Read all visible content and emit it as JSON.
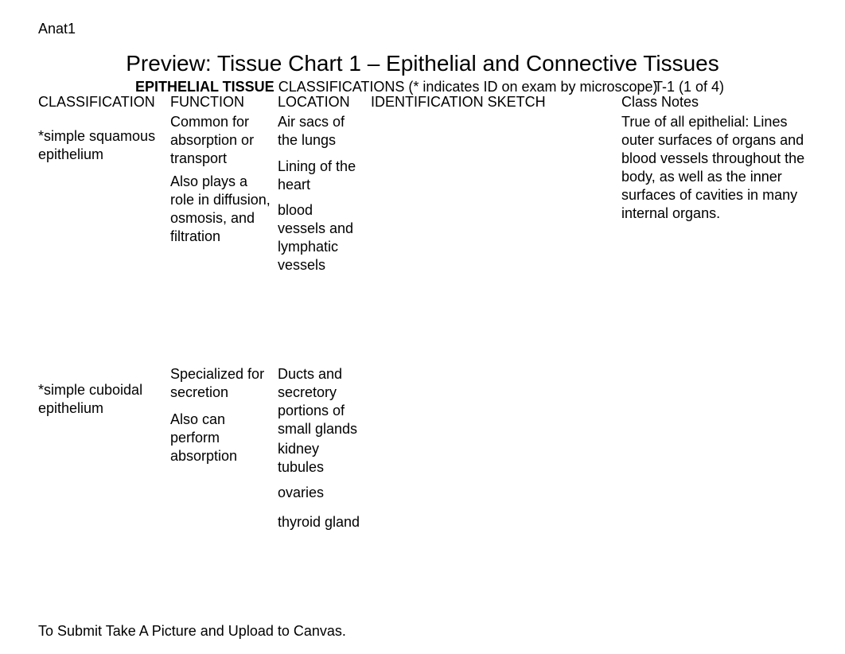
{
  "course": "Anat1",
  "title": "Preview: Tissue Chart 1 – Epithelial and Connective Tissues",
  "subhead_bold": "EPITHELIAL TISSUE",
  "subhead_rest": " CLASSIFICATIONS (* indicates ID on exam by microscope)",
  "page_label": "T-1 (1 of 4)",
  "columns": {
    "c1": "CLASSIFICATION",
    "c2": "FUNCTION",
    "c3": "LOCATION",
    "c4": "IDENTIFICATION SKETCH",
    "c5": "Class Notes"
  },
  "rows": [
    {
      "classification": "*simple squamous epithelium",
      "function": [
        "Common for absorption or transport",
        "Also plays a role in diffusion, osmosis, and filtration"
      ],
      "location": [
        "Air sacs of the lungs",
        "Lining of the heart",
        "blood vessels and lymphatic vessels"
      ],
      "notes": "True of all epithelial: Lines outer surfaces of organs and blood vessels throughout the body, as well as the inner surfaces of cavities in many internal organs."
    },
    {
      "classification": "*simple cuboidal epithelium",
      "function": [
        "Specialized for secretion",
        "Also can perform absorption"
      ],
      "location": [
        "Ducts and secretory portions of small glands",
        "kidney tubules",
        "ovaries",
        "thyroid gland"
      ],
      "notes": ""
    }
  ],
  "footer": "To Submit Take A Picture and Upload to Canvas."
}
